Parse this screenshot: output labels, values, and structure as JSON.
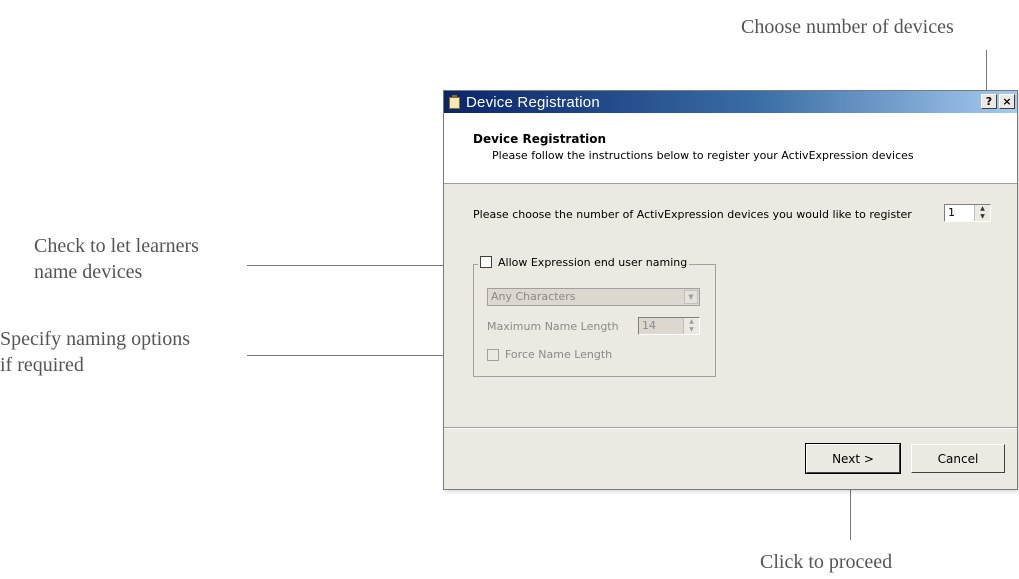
{
  "callouts": {
    "devices": "Choose number of devices",
    "learners_line1": "Check to let learners",
    "learners_line2": "name devices",
    "naming_line1": "Specify naming options",
    "naming_line2": "if required",
    "proceed": "Click to proceed"
  },
  "dialog": {
    "title": "Device Registration",
    "help_label": "?",
    "close_label": "×",
    "header_title": "Device Registration",
    "header_subtitle": "Please follow the instructions below to register your ActivExpression devices",
    "choose_label": "Please choose the number of ActivExpression devices you would like to register",
    "device_count": "1",
    "allow_naming_label": "Allow Expression end user naming",
    "allow_naming_checked": false,
    "naming_type": "Any Characters",
    "max_name_length_label": "Maximum Name Length",
    "max_name_length": "14",
    "force_name_length_label": "Force Name Length",
    "force_name_length_checked": false,
    "next_label": "Next >",
    "cancel_label": "Cancel"
  },
  "icons": [
    "clipboard-icon",
    "spin-up-icon",
    "spin-down-icon",
    "dropdown-arrow-icon"
  ]
}
